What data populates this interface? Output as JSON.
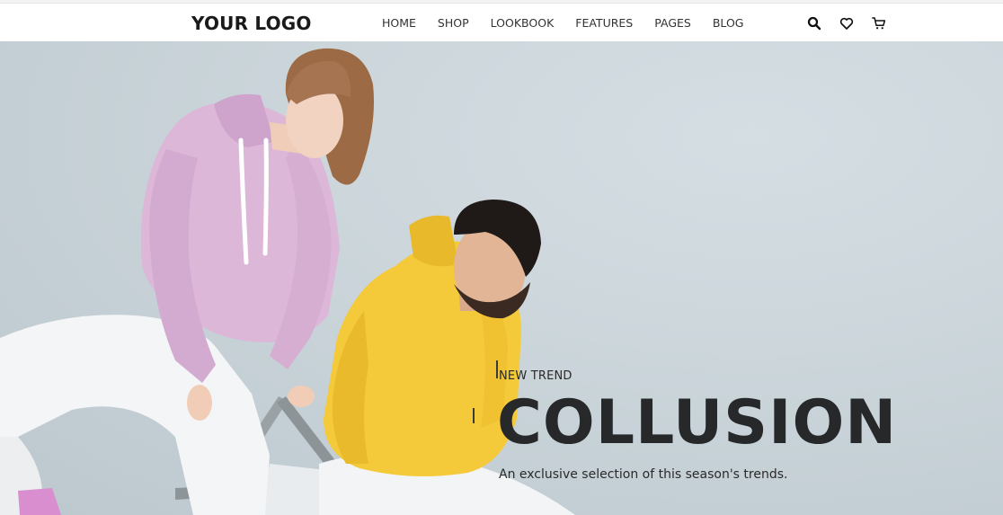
{
  "header": {
    "logo": "YOUR LOGO",
    "nav": [
      {
        "label": "HOME"
      },
      {
        "label": "SHOP"
      },
      {
        "label": "LOOKBOOK"
      },
      {
        "label": "FEATURES"
      },
      {
        "label": "PAGES"
      },
      {
        "label": "BLOG"
      }
    ],
    "icons": [
      "search-icon",
      "heart-icon",
      "cart-icon"
    ]
  },
  "hero": {
    "eyebrow": "NEW TREND",
    "title": "COLLUSION",
    "subtitle": "An exclusive selection of this season's trends.",
    "colors": {
      "background": "#cdd7dc",
      "pink_hoodie": "#dcb7d8",
      "yellow_hoodie": "#f4c93a",
      "title_text": "#262829"
    }
  }
}
